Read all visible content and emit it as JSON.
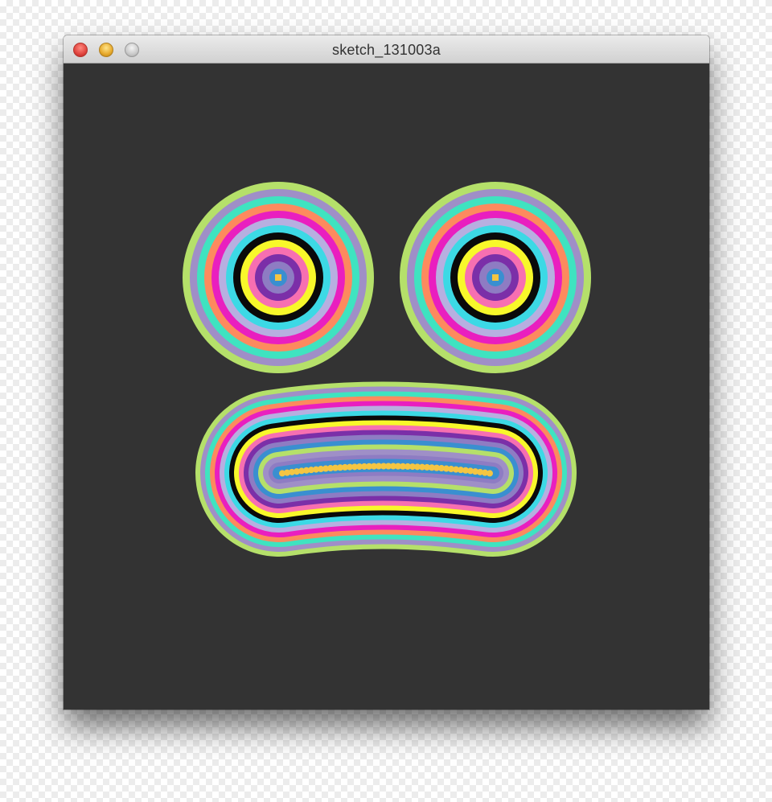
{
  "window": {
    "title": "sketch_131003a",
    "controls": [
      {
        "name": "close-button",
        "color": "#e0443e"
      },
      {
        "name": "minimize-button",
        "color": "#e6a82a"
      },
      {
        "name": "zoom-button",
        "color": "#c9c9c9"
      }
    ]
  },
  "sketch": {
    "background": "#333333",
    "ring_palette": [
      "#b5e06a",
      "#9f8fc7",
      "#3fe3c0",
      "#fd8a5e",
      "#e91fbf",
      "#b7afe0",
      "#3cd9e5",
      "#0a0a0a",
      "#f8f82a",
      "#f76fb1",
      "#7b2fa8",
      "#8e7cc3",
      "#3a8fd0",
      "#f4c542"
    ],
    "mouth_center_dots": "#f4c542"
  }
}
